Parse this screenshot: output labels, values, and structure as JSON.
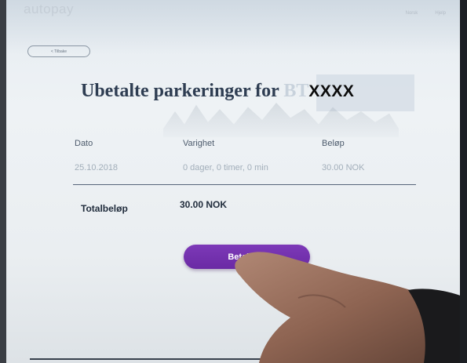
{
  "app": {
    "brand": "autopay"
  },
  "topnav": {
    "items": [
      "Norsk",
      "Hjelp"
    ]
  },
  "back": {
    "label": "< Tilbake"
  },
  "page": {
    "title_prefix": "Ubetalte parkeringer for",
    "plate_visible": "BT",
    "plate_masked": "XXXX"
  },
  "table": {
    "headers": [
      "Dato",
      "Varighet",
      "Beløp"
    ],
    "rows": [
      [
        "25.10.2018",
        "0 dager, 0 timer, 0 min",
        "30.00 NOK"
      ]
    ]
  },
  "total": {
    "label": "Totalbeløp",
    "value": "30.00 NOK"
  },
  "actions": {
    "pay_label": "Betal alle"
  },
  "colors": {
    "accent": "#7436ae",
    "title": "#2e3d52"
  }
}
